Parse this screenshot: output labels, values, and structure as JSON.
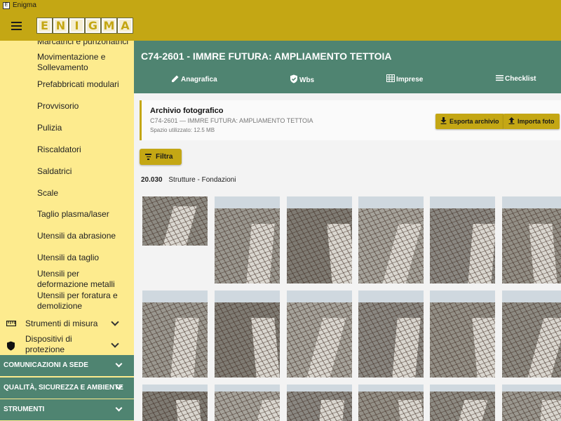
{
  "window": {
    "title": "Enigma"
  },
  "header": {
    "logo_letters": [
      "E",
      "N",
      "I",
      "G",
      "M",
      "A"
    ]
  },
  "sidebar": {
    "sub_items": [
      "Marcatrici e punzonatrici",
      "Movimentazione e Sollevamento",
      "Prefabbricati modulari",
      "Provvisorio",
      "Pulizia",
      "Riscaldatori",
      "Saldatrici",
      "Scale",
      "Taglio plasma/laser",
      "Utensili da abrasione",
      "Utensili da taglio",
      "Utensili per deformazione metalli",
      "Utensili per foratura e demolizione"
    ],
    "groups": [
      {
        "label": "Strumenti di misura",
        "icon": "ruler-icon"
      },
      {
        "label": "Dispositivi di protezione",
        "icon": "shield-icon"
      }
    ],
    "sections": [
      "COMUNICAZIONI A SEDE",
      "QUALITÀ, SICUREZZA E AMBIENTE",
      "STRUMENTI"
    ]
  },
  "project": {
    "title": "C74-2601 - IMMRE FUTURA: AMPLIAMENTO TETTOIA",
    "tabs": [
      {
        "label": "Anagrafica",
        "icon": "pencil-icon"
      },
      {
        "label": "Wbs",
        "icon": "shield-check-icon"
      },
      {
        "label": "Imprese",
        "icon": "table-icon"
      },
      {
        "label": "Checklist",
        "icon": "list-icon"
      }
    ]
  },
  "archive": {
    "title": "Archivio fotografico",
    "subtitle": "C74-2601 — IMMRE FUTURA: AMPLIAMENTO TETTOIA",
    "space": "Spazio utilizzato: 12.5 MB",
    "export_label": "Esporta archivio",
    "import_label": "Importa foto"
  },
  "filter": {
    "label": "Filtra"
  },
  "category": {
    "code": "20.030",
    "name": "Strutture - Fondazioni"
  },
  "colors": {
    "accent": "#c4a714",
    "primary": "#4f8471",
    "sidebar_bg": "#fdeb8e"
  }
}
